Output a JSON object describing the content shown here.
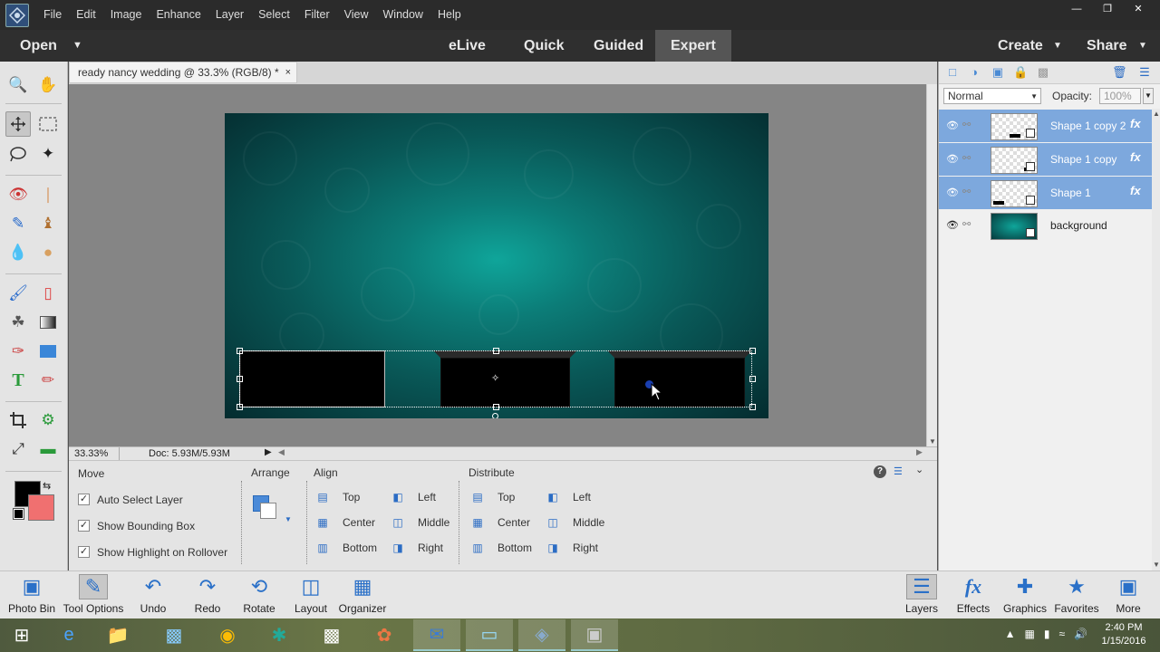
{
  "menubar": {
    "items": [
      "File",
      "Edit",
      "Image",
      "Enhance",
      "Layer",
      "Select",
      "Filter",
      "View",
      "Window",
      "Help"
    ]
  },
  "modebar": {
    "open": "Open",
    "modes": [
      "eLive",
      "Quick",
      "Guided",
      "Expert"
    ],
    "create": "Create",
    "share": "Share"
  },
  "document": {
    "tab_title": "ready nancy wedding @ 33.3% (RGB/8) *",
    "zoom": "33.33%",
    "doc_size": "Doc: 5.93M/5.93M"
  },
  "options": {
    "move_title": "Move",
    "checkboxes": [
      "Auto Select Layer",
      "Show Bounding Box",
      "Show Highlight on Rollover"
    ],
    "arrange_title": "Arrange",
    "align_title": "Align",
    "align": [
      "Top",
      "Center",
      "Bottom",
      "Left",
      "Middle",
      "Right"
    ],
    "distribute_title": "Distribute",
    "distribute": [
      "Top",
      "Center",
      "Bottom",
      "Left",
      "Middle",
      "Right"
    ]
  },
  "layers": {
    "blend_mode": "Normal",
    "opacity_label": "Opacity:",
    "opacity": "100%",
    "fx": "fx",
    "items": [
      {
        "name": "Shape 1 copy 2",
        "selected": true,
        "fx": true
      },
      {
        "name": "Shape 1 copy",
        "selected": true,
        "fx": true
      },
      {
        "name": "Shape 1",
        "selected": true,
        "fx": true
      },
      {
        "name": "background",
        "selected": false,
        "fx": false
      }
    ]
  },
  "bottombar": {
    "left": [
      "Photo Bin",
      "Tool Options",
      "Undo",
      "Redo",
      "Rotate",
      "Layout",
      "Organizer"
    ],
    "right": [
      "Layers",
      "Effects",
      "Graphics",
      "Favorites",
      "More"
    ]
  },
  "taskbar": {
    "time": "2:40 PM",
    "date": "1/15/2016"
  },
  "colors": {
    "foreground": "#000000",
    "background": "#f07070",
    "selected_layer": "#7da8dd"
  }
}
